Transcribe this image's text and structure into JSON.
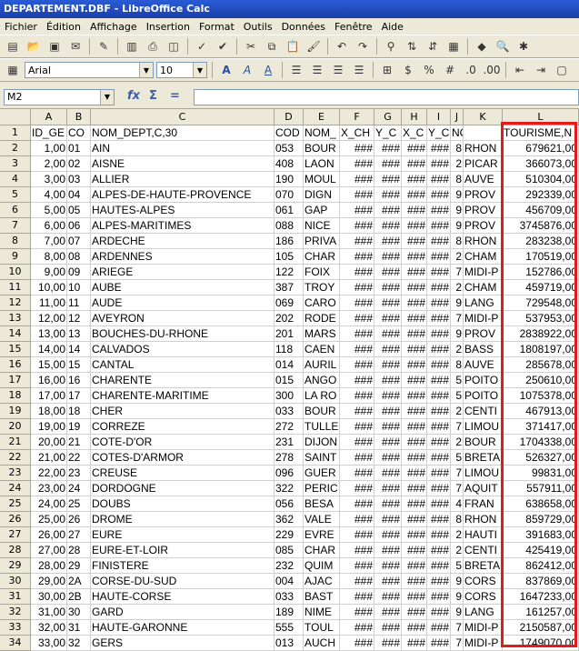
{
  "window": {
    "title": "DEPARTEMENT.DBF - LibreOffice Calc"
  },
  "menu": [
    "Fichier",
    "Édition",
    "Affichage",
    "Insertion",
    "Format",
    "Outils",
    "Données",
    "Fenêtre",
    "Aide"
  ],
  "formatting": {
    "font_name": "Arial",
    "font_size": "10"
  },
  "formula_bar": {
    "cell_ref": "M2",
    "content": ""
  },
  "columns": [
    "A",
    "B",
    "C",
    "D",
    "E",
    "F",
    "G",
    "H",
    "I",
    "J",
    "K",
    "L"
  ],
  "header_row": [
    "ID_GE",
    "CO",
    "NOM_DEPT,C,30",
    "COD",
    "NOM_",
    "X_CH",
    "Y_C",
    "X_C",
    "Y_C",
    "NOM_",
    "",
    "TOURISME,N"
  ],
  "rows": [
    [
      "1,00",
      "01",
      "AIN",
      "053",
      "BOUR",
      "###",
      "###",
      "###",
      "###",
      "8",
      "RHON",
      "679621,00"
    ],
    [
      "2,00",
      "02",
      "AISNE",
      "408",
      "LAON",
      "###",
      "###",
      "###",
      "###",
      "2",
      "PICAR",
      "366073,00"
    ],
    [
      "3,00",
      "03",
      "ALLIER",
      "190",
      "MOUL",
      "###",
      "###",
      "###",
      "###",
      "8",
      "AUVE",
      "510304,00"
    ],
    [
      "4,00",
      "04",
      "ALPES-DE-HAUTE-PROVENCE",
      "070",
      "DIGN",
      "###",
      "###",
      "###",
      "###",
      "9",
      "PROV",
      "292339,00"
    ],
    [
      "5,00",
      "05",
      "HAUTES-ALPES",
      "061",
      "GAP",
      "###",
      "###",
      "###",
      "###",
      "9",
      "PROV",
      "456709,00"
    ],
    [
      "6,00",
      "06",
      "ALPES-MARITIMES",
      "088",
      "NICE",
      "###",
      "###",
      "###",
      "###",
      "9",
      "PROV",
      "3745876,00"
    ],
    [
      "7,00",
      "07",
      "ARDECHE",
      "186",
      "PRIVA",
      "###",
      "###",
      "###",
      "###",
      "8",
      "RHON",
      "283238,00"
    ],
    [
      "8,00",
      "08",
      "ARDENNES",
      "105",
      "CHAR",
      "###",
      "###",
      "###",
      "###",
      "2",
      "CHAM",
      "170519,00"
    ],
    [
      "9,00",
      "09",
      "ARIEGE",
      "122",
      "FOIX",
      "###",
      "###",
      "###",
      "###",
      "7",
      "MIDI-P",
      "152786,00"
    ],
    [
      "10,00",
      "10",
      "AUBE",
      "387",
      "TROY",
      "###",
      "###",
      "###",
      "###",
      "2",
      "CHAM",
      "459719,00"
    ],
    [
      "11,00",
      "11",
      "AUDE",
      "069",
      "CARO",
      "###",
      "###",
      "###",
      "###",
      "9",
      "LANG",
      "729548,00"
    ],
    [
      "12,00",
      "12",
      "AVEYRON",
      "202",
      "RODE",
      "###",
      "###",
      "###",
      "###",
      "7",
      "MIDI-P",
      "537953,00"
    ],
    [
      "13,00",
      "13",
      "BOUCHES-DU-RHONE",
      "201",
      "MARS",
      "###",
      "###",
      "###",
      "###",
      "9",
      "PROV",
      "2838922,00"
    ],
    [
      "14,00",
      "14",
      "CALVADOS",
      "118",
      "CAEN",
      "###",
      "###",
      "###",
      "###",
      "2",
      "BASS",
      "1808197,00"
    ],
    [
      "15,00",
      "15",
      "CANTAL",
      "014",
      "AURIL",
      "###",
      "###",
      "###",
      "###",
      "8",
      "AUVE",
      "285678,00"
    ],
    [
      "16,00",
      "16",
      "CHARENTE",
      "015",
      "ANGO",
      "###",
      "###",
      "###",
      "###",
      "5",
      "POITO",
      "250610,00"
    ],
    [
      "17,00",
      "17",
      "CHARENTE-MARITIME",
      "300",
      "LA RO",
      "###",
      "###",
      "###",
      "###",
      "5",
      "POITO",
      "1075378,00"
    ],
    [
      "18,00",
      "18",
      "CHER",
      "033",
      "BOUR",
      "###",
      "###",
      "###",
      "###",
      "2",
      "CENTI",
      "467913,00"
    ],
    [
      "19,00",
      "19",
      "CORREZE",
      "272",
      "TULLE",
      "###",
      "###",
      "###",
      "###",
      "7",
      "LIMOU",
      "371417,00"
    ],
    [
      "20,00",
      "21",
      "COTE-D'OR",
      "231",
      "DIJON",
      "###",
      "###",
      "###",
      "###",
      "2",
      "BOUR",
      "1704338,00"
    ],
    [
      "21,00",
      "22",
      "COTES-D'ARMOR",
      "278",
      "SAINT",
      "###",
      "###",
      "###",
      "###",
      "5",
      "BRETA",
      "526327,00"
    ],
    [
      "22,00",
      "23",
      "CREUSE",
      "096",
      "GUER",
      "###",
      "###",
      "###",
      "###",
      "7",
      "LIMOU",
      "99831,00"
    ],
    [
      "23,00",
      "24",
      "DORDOGNE",
      "322",
      "PERIC",
      "###",
      "###",
      "###",
      "###",
      "7",
      "AQUIT",
      "557911,00"
    ],
    [
      "24,00",
      "25",
      "DOUBS",
      "056",
      "BESA",
      "###",
      "###",
      "###",
      "###",
      "4",
      "FRAN",
      "638658,00"
    ],
    [
      "25,00",
      "26",
      "DROME",
      "362",
      "VALE",
      "###",
      "###",
      "###",
      "###",
      "8",
      "RHON",
      "859729,00"
    ],
    [
      "26,00",
      "27",
      "EURE",
      "229",
      "EVRE",
      "###",
      "###",
      "###",
      "###",
      "2",
      "HAUTI",
      "391683,00"
    ],
    [
      "27,00",
      "28",
      "EURE-ET-LOIR",
      "085",
      "CHAR",
      "###",
      "###",
      "###",
      "###",
      "2",
      "CENTI",
      "425419,00"
    ],
    [
      "28,00",
      "29",
      "FINISTERE",
      "232",
      "QUIM",
      "###",
      "###",
      "###",
      "###",
      "5",
      "BRETA",
      "862412,00"
    ],
    [
      "29,00",
      "2A",
      "CORSE-DU-SUD",
      "004",
      "AJAC",
      "###",
      "###",
      "###",
      "###",
      "9",
      "CORS",
      "837869,00"
    ],
    [
      "30,00",
      "2B",
      "HAUTE-CORSE",
      "033",
      "BAST",
      "###",
      "###",
      "###",
      "###",
      "9",
      "CORS",
      "1647233,00"
    ],
    [
      "31,00",
      "30",
      "GARD",
      "189",
      "NIME",
      "###",
      "###",
      "###",
      "###",
      "9",
      "LANG",
      "161257,00"
    ],
    [
      "32,00",
      "31",
      "HAUTE-GARONNE",
      "555",
      "TOUL",
      "###",
      "###",
      "###",
      "###",
      "7",
      "MIDI-P",
      "2150587,00"
    ],
    [
      "33,00",
      "32",
      "GERS",
      "013",
      "AUCH",
      "###",
      "###",
      "###",
      "###",
      "7",
      "MIDI-P",
      "1749070,00"
    ]
  ],
  "colors": {
    "selection_highlight": "#e21b1b",
    "titlebar": "#1a3fa8"
  }
}
